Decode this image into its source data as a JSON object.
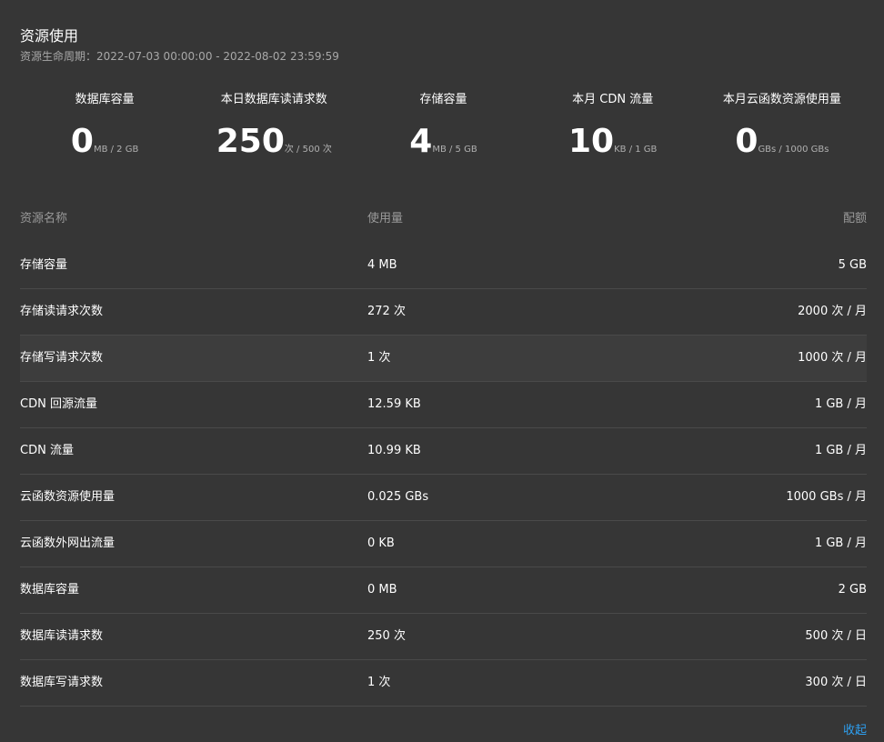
{
  "header": {
    "title": "资源使用",
    "period": "资源生命周期：2022-07-03 00:00:00 - 2022-08-02 23:59:59"
  },
  "stats": [
    {
      "label": "数据库容量",
      "value": "0",
      "unit": "MB / 2 GB"
    },
    {
      "label": "本日数据库读请求数",
      "value": "250",
      "unit": "次 / 500 次"
    },
    {
      "label": "存储容量",
      "value": "4",
      "unit": "MB / 5 GB"
    },
    {
      "label": "本月 CDN 流量",
      "value": "10",
      "unit": "KB / 1 GB"
    },
    {
      "label": "本月云函数资源使用量",
      "value": "0",
      "unit": "GBs / 1000 GBs"
    }
  ],
  "table": {
    "headers": [
      "资源名称",
      "使用量",
      "配额"
    ],
    "rows": [
      [
        "存储容量",
        "4 MB",
        "5 GB"
      ],
      [
        "存储读请求次数",
        "272 次",
        "2000 次 / 月"
      ],
      [
        "存储写请求次数",
        "1 次",
        "1000 次 / 月"
      ],
      [
        "CDN 回源流量",
        "12.59 KB",
        "1 GB / 月"
      ],
      [
        "CDN 流量",
        "10.99 KB",
        "1 GB / 月"
      ],
      [
        "云函数资源使用量",
        "0.025 GBs",
        "1000 GBs / 月"
      ],
      [
        "云函数外网出流量",
        "0 KB",
        "1 GB / 月"
      ],
      [
        "数据库容量",
        "0 MB",
        "2 GB"
      ],
      [
        "数据库读请求数",
        "250 次",
        "500 次 / 日"
      ],
      [
        "数据库写请求数",
        "1 次",
        "300 次 / 日"
      ]
    ]
  },
  "collapse_label": "收起",
  "colors": {
    "background": "#363636",
    "link": "#2d9ff0",
    "row_highlight": "#3d3d3d"
  }
}
